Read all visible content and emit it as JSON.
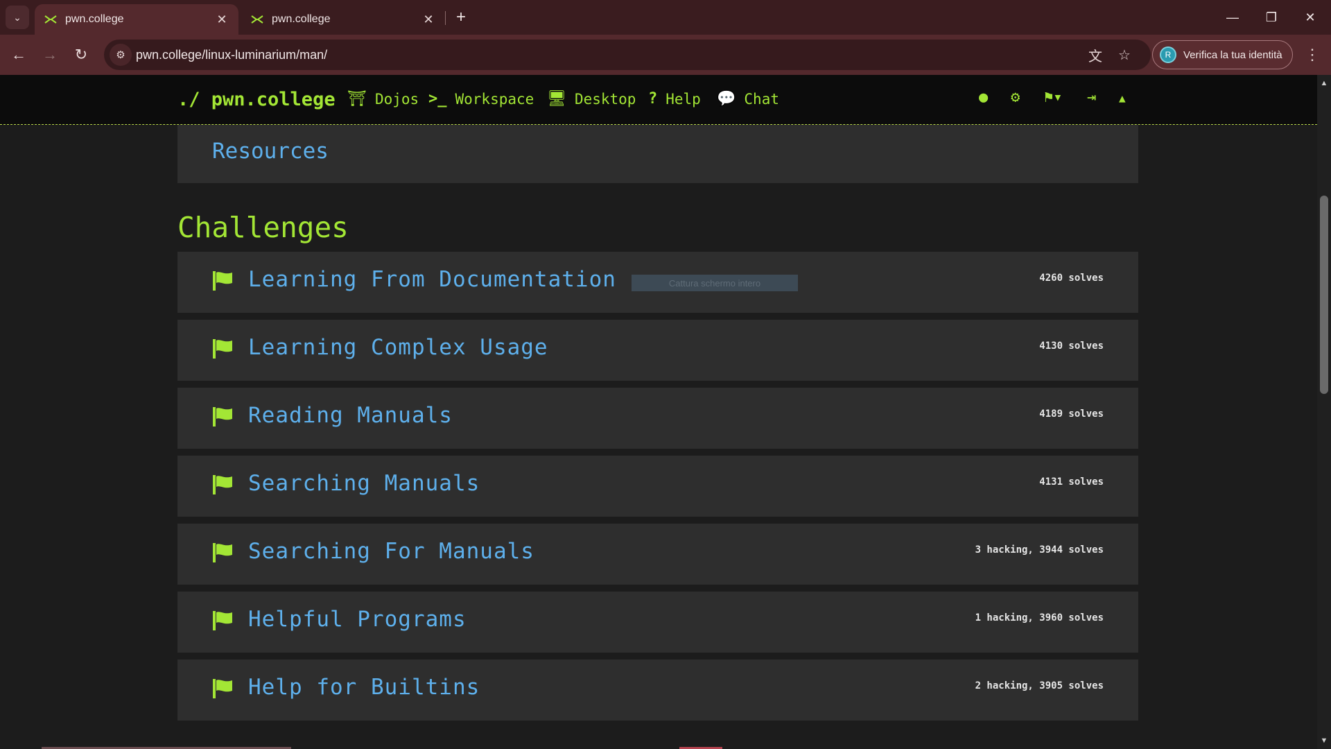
{
  "browser": {
    "tabs": [
      {
        "title": "pwn.college",
        "active": true
      },
      {
        "title": "pwn.college",
        "active": false
      }
    ],
    "url": "pwn.college/linux-luminarium/man/",
    "profile_label": "Verifica la tua identità",
    "profile_initial": "R"
  },
  "site_nav": {
    "brand": "./ pwn.college",
    "items": [
      {
        "label": "Dojos",
        "icon": "torii-gate-icon"
      },
      {
        "label": "Workspace",
        "icon": "terminal-icon"
      },
      {
        "label": "Desktop",
        "icon": "desktop-icon"
      },
      {
        "label": "Help",
        "icon": "question-icon"
      },
      {
        "label": "Chat",
        "icon": "comments-icon"
      }
    ]
  },
  "resources_label": "Resources",
  "challenges_heading": "Challenges",
  "capture_tooltip": "Cattura schermo intero",
  "challenges": [
    {
      "title": "Learning From Documentation",
      "stats": "4260 solves"
    },
    {
      "title": "Learning Complex Usage",
      "stats": "4130 solves"
    },
    {
      "title": "Reading Manuals",
      "stats": "4189 solves"
    },
    {
      "title": "Searching Manuals",
      "stats": "4131 solves"
    },
    {
      "title": "Searching For Manuals",
      "stats": "3 hacking, 3944 solves"
    },
    {
      "title": "Helpful Programs",
      "stats": "1 hacking, 3960 solves"
    },
    {
      "title": "Help for Builtins",
      "stats": "2 hacking, 3905 solves"
    }
  ],
  "colors": {
    "accent_green": "#a3e635",
    "link_blue": "#5eb0ec",
    "chrome_dark": "#3a1c1f",
    "chrome_toolbar": "#54292d"
  }
}
